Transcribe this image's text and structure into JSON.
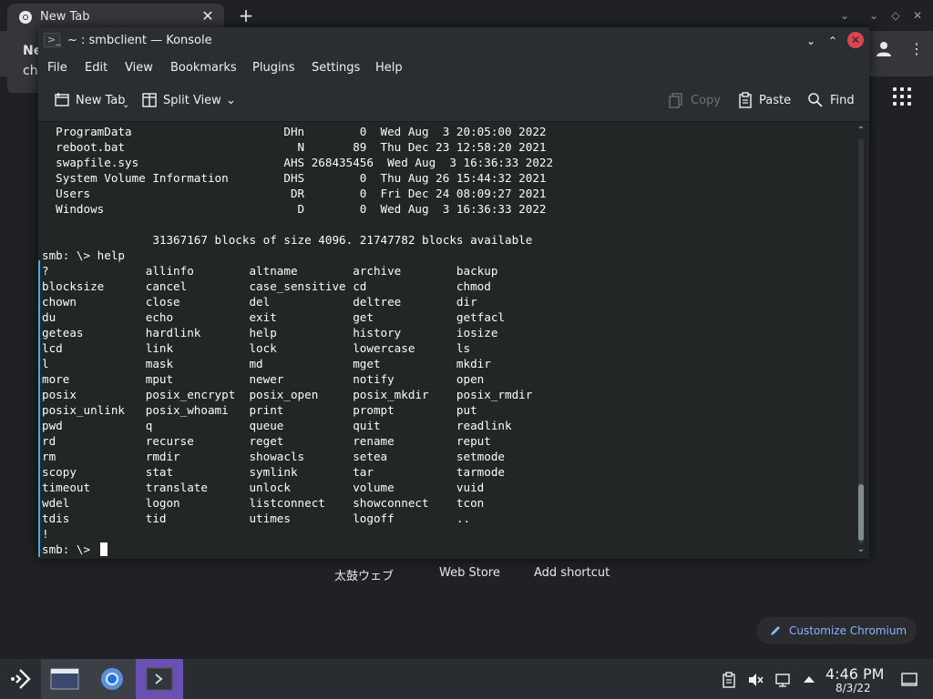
{
  "chromium": {
    "tab_title": "New Tab",
    "popup_title": "Ne",
    "popup_text": "ch",
    "shortcuts": [
      "太鼓ウェブ",
      "Web Store",
      "Add shortcut"
    ],
    "customize_label": "Customize Chromium"
  },
  "konsole": {
    "window_title": "~ : smbclient — Konsole",
    "menu": [
      "File",
      "Edit",
      "View",
      "Bookmarks",
      "Plugins",
      "Settings",
      "Help"
    ],
    "toolbar": {
      "new_tab": "New Tab",
      "split_view": "Split View",
      "copy": "Copy",
      "paste": "Paste",
      "find": "Find"
    },
    "terminal_lines": [
      "  ProgramData                      DHn        0  Wed Aug  3 20:05:00 2022",
      "  reboot.bat                         N       89  Thu Dec 23 12:58:20 2021",
      "  swapfile.sys                     AHS 268435456  Wed Aug  3 16:36:33 2022",
      "  System Volume Information        DHS        0  Thu Aug 26 15:44:32 2021",
      "  Users                             DR        0  Fri Dec 24 08:09:27 2021",
      "  Windows                            D        0  Wed Aug  3 16:36:33 2022",
      "",
      "                31367167 blocks of size 4096. 21747782 blocks available",
      "smb: \\> help",
      "?              allinfo        altname        archive        backup",
      "blocksize      cancel         case_sensitive cd             chmod",
      "chown          close          del            deltree        dir",
      "du             echo           exit           get            getfacl",
      "geteas         hardlink       help           history        iosize",
      "lcd            link           lock           lowercase      ls",
      "l              mask           md             mget           mkdir",
      "more           mput           newer          notify         open",
      "posix          posix_encrypt  posix_open     posix_mkdir    posix_rmdir",
      "posix_unlink   posix_whoami   print          prompt         put",
      "pwd            q              queue          quit           readlink",
      "rd             recurse        reget          rename         reput",
      "rm             rmdir          showacls       setea          setmode",
      "scopy          stat           symlink        tar            tarmode",
      "timeout        translate      unlock         volume         vuid",
      "wdel           logon          listconnect    showconnect    tcon",
      "tdis           tid            utimes         logoff         ..",
      "!",
      "smb: \\> "
    ]
  },
  "taskbar": {
    "time": "4:46 PM",
    "date": "8/3/22"
  },
  "colors": {
    "terminal_bg": "#232627",
    "terminal_fg": "#fcfcfc",
    "accent": "#3daee9",
    "active_task": "#6a4fb5",
    "close_red": "#da4453"
  }
}
